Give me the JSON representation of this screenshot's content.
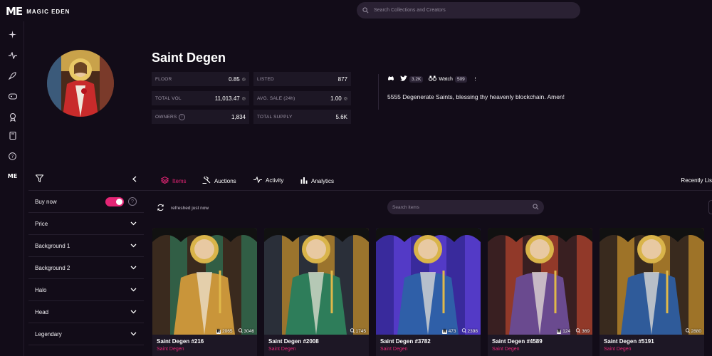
{
  "brand": {
    "mark": "ME",
    "name": "MAGIC EDEN"
  },
  "search": {
    "placeholder": "Search Collections and Creators"
  },
  "rail": [
    "sparkle-icon",
    "activity-icon",
    "rocket-icon",
    "gamepad-icon",
    "award-icon",
    "book-icon",
    "help-icon",
    "me-icon"
  ],
  "collection": {
    "title": "Saint Degen",
    "stats": [
      {
        "label": "FLOOR",
        "value": "0.85",
        "sol": true
      },
      {
        "label": "LISTED",
        "value": "877",
        "sol": false
      },
      {
        "label": "TOTAL VOL",
        "value": "11,013.47",
        "sol": true
      },
      {
        "label": "AVG. SALE (24h)",
        "value": "1.00",
        "sol": true
      },
      {
        "label": "OWNERS",
        "value": "1,834",
        "sol": false,
        "info": true
      },
      {
        "label": "TOTAL SUPPLY",
        "value": "5.6K",
        "sol": false
      }
    ],
    "twitter_count": "3.2K",
    "watch_label": "Watch",
    "watch_count": "509",
    "description": "5555 Degenerate Saints, blessing thy heavenly blockchain. Amen!"
  },
  "filters": {
    "buy_now": "Buy now",
    "buy_now_on": true,
    "items": [
      "Price",
      "Background 1",
      "Background 2",
      "Halo",
      "Head",
      "Legendary"
    ]
  },
  "tabs": [
    {
      "label": "Items",
      "icon": "layers-icon",
      "active": true
    },
    {
      "label": "Auctions",
      "icon": "gavel-icon",
      "active": false
    },
    {
      "label": "Activity",
      "icon": "activity-icon",
      "active": false
    },
    {
      "label": "Analytics",
      "icon": "bar-chart-icon",
      "active": false
    }
  ],
  "sort_label": "Recently Lis",
  "refresh_text": "refreshed just now",
  "items_search": {
    "placeholder": "Search items"
  },
  "cards": [
    {
      "name": "Saint Degen #216",
      "collection": "Saint Degen",
      "rank": "2065",
      "owners": "3046",
      "robe": "#c9953a",
      "bg": "#3b2a1e",
      "glass": "#2f6b4f"
    },
    {
      "name": "Saint Degen #2008",
      "collection": "Saint Degen",
      "rank": "",
      "owners": "1745",
      "robe": "#2e7d5a",
      "bg": "#2a2f3a",
      "glass": "#b8862a"
    },
    {
      "name": "Saint Degen #3782",
      "collection": "Saint Degen",
      "rank": "473",
      "owners": "2398",
      "robe": "#2f5fa8",
      "bg": "#3a2a9c",
      "glass": "#5a3fd1"
    },
    {
      "name": "Saint Degen #4589",
      "collection": "Saint Degen",
      "rank": "124",
      "owners": "369",
      "robe": "#6a4a8f",
      "bg": "#3a1f22",
      "glass": "#a8402c"
    },
    {
      "name": "Saint Degen #5191",
      "collection": "Saint Degen",
      "rank": "",
      "owners": "2880",
      "robe": "#2f5b9a",
      "bg": "#3a2b1e",
      "glass": "#b8862a"
    }
  ],
  "colors": {
    "accent": "#e42575",
    "panel": "#1d1725",
    "bg": "#120c18"
  }
}
